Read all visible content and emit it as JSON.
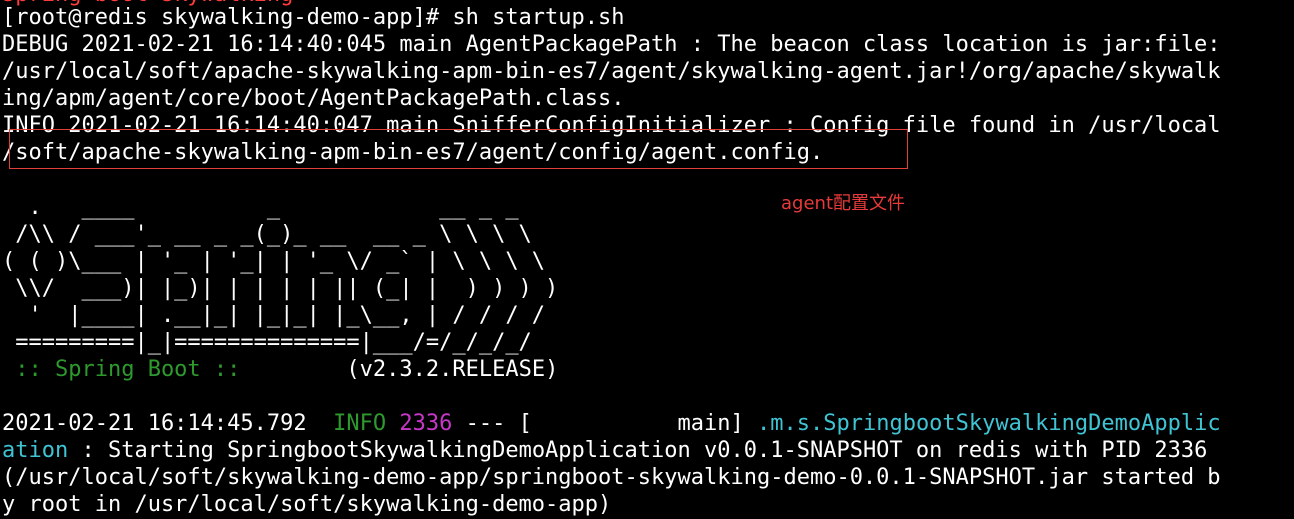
{
  "terminal": {
    "partial_top_line": "spring-boot-skywalking",
    "prompt": "[root@redis skywalking-demo-app]# sh startup.sh",
    "agent_log": [
      "DEBUG 2021-02-21 16:14:40:045 main AgentPackagePath : The beacon class location is jar:file:",
      "/usr/local/soft/apache-skywalking-apm-bin-es7/agent/skywalking-agent.jar!/org/apache/skywalk",
      "ing/apm/agent/core/boot/AgentPackagePath.class.",
      "INFO 2021-02-21 16:14:40:047 main SnifferConfigInitializer : Config file found in /usr/local",
      "/soft/apache-skywalking-apm-bin-es7/agent/config/agent.config."
    ],
    "banner": [
      "  .   ____          _            __ _ _",
      " /\\\\ / ___'_ __ _ _(_)_ __  __ _ \\ \\ \\ \\",
      "( ( )\\___ | '_ | '_| | '_ \\/ _` | \\ \\ \\ \\",
      " \\\\/  ___)| |_)| | | | | || (_| |  ) ) ) )",
      "  '  |____| .__|_| |_|_| |_\\__, | / / / /",
      " =========|_|==============|___/=/_/_/_/"
    ],
    "spring_boot_label": " :: Spring Boot :: ",
    "spring_boot_version": "       (v2.3.2.RELEASE)",
    "app_log": {
      "timestamp": "2021-02-21 16:14:45.792",
      "level": "INFO",
      "pid": "2336",
      "separator": " --- [           main] ",
      "logger_part1": ".m.s.SpringbootSkywalkingDemoApplic",
      "logger_part2": "ation",
      "message_part1": " : Starting SpringbootSkywalkingDemoApplication v0.0.1-SNAPSHOT on redis with PID 2336",
      "message_line2": "(/usr/local/soft/skywalking-demo-app/springboot-skywalking-demo-0.0.1-SNAPSHOT.jar started b",
      "message_line3": "y root in /usr/local/soft/skywalking-demo-app)"
    }
  },
  "annotation": {
    "label": "agent配置文件",
    "color": "#e83a3a"
  },
  "colors": {
    "background": "#000000",
    "text": "#ffffff",
    "info_green": "#2e9a2e",
    "pid_purple": "#c838c8",
    "logger_cyan": "#3fc4d4",
    "highlight_red": "#e0403a"
  }
}
